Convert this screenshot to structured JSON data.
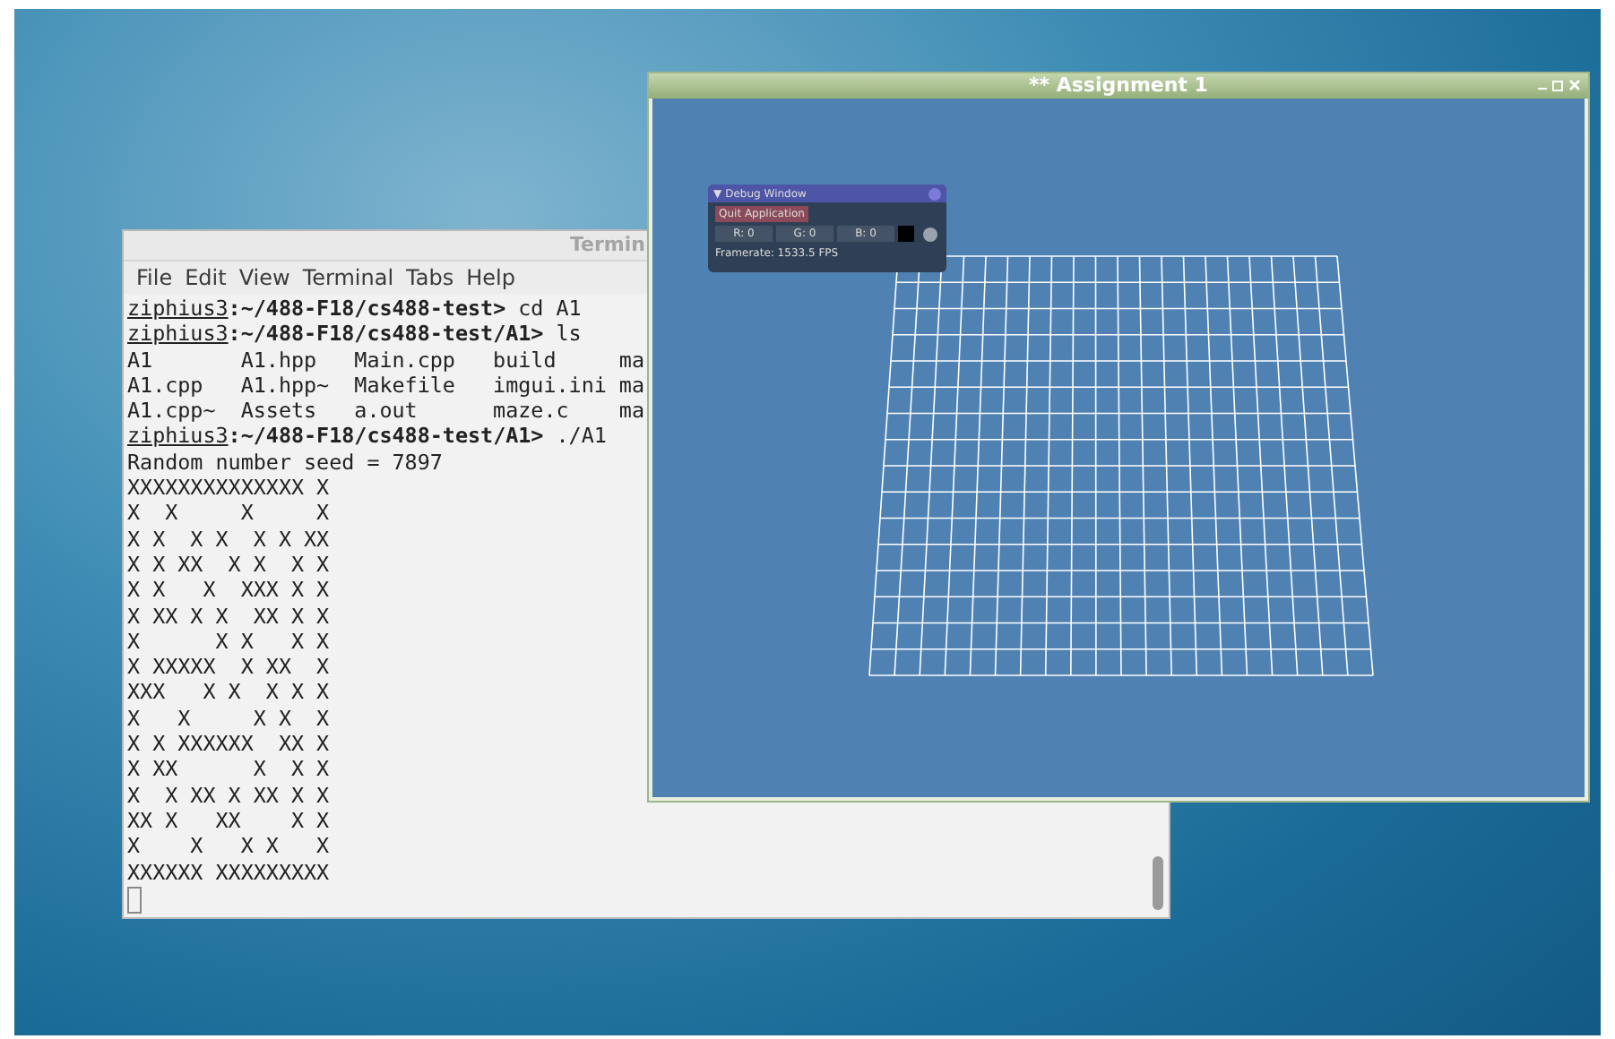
{
  "terminal": {
    "title": "Termin",
    "menu": [
      "File",
      "Edit",
      "View",
      "Terminal",
      "Tabs",
      "Help"
    ],
    "lines": [
      {
        "kind": "prompt",
        "user": "ziphius3",
        "path": ":~/488-F18/cs488-test>",
        "command": " cd A1"
      },
      {
        "kind": "prompt",
        "user": "ziphius3",
        "path": ":~/488-F18/cs488-test/A1>",
        "command": " ls"
      },
      {
        "kind": "output",
        "text": "A1       A1.hpp   Main.cpp   build     ma"
      },
      {
        "kind": "output",
        "text": "A1.cpp   A1.hpp~  Makefile   imgui.ini ma"
      },
      {
        "kind": "output",
        "text": "A1.cpp~  Assets   a.out      maze.c    ma"
      },
      {
        "kind": "prompt",
        "user": "ziphius3",
        "path": ":~/488-F18/cs488-test/A1>",
        "command": " ./A1"
      },
      {
        "kind": "output",
        "text": "Random number seed = 7897"
      },
      {
        "kind": "output",
        "text": "XXXXXXXXXXXXXX X"
      },
      {
        "kind": "output",
        "text": "X  X     X     X"
      },
      {
        "kind": "output",
        "text": "X X  X X  X X XX"
      },
      {
        "kind": "output",
        "text": "X X XX  X X  X X"
      },
      {
        "kind": "output",
        "text": "X X   X  XXX X X"
      },
      {
        "kind": "output",
        "text": "X XX X X  XX X X"
      },
      {
        "kind": "output",
        "text": "X      X X   X X"
      },
      {
        "kind": "output",
        "text": "X XXXXX  X XX  X"
      },
      {
        "kind": "output",
        "text": "XXX   X X  X X X"
      },
      {
        "kind": "output",
        "text": "X   X     X X  X"
      },
      {
        "kind": "output",
        "text": "X X XXXXXX  XX X"
      },
      {
        "kind": "output",
        "text": "X XX      X  X X"
      },
      {
        "kind": "output",
        "text": "X  X XX X XX X X"
      },
      {
        "kind": "output",
        "text": "XX X   XX    X X"
      },
      {
        "kind": "output",
        "text": "X    X   X X   X"
      },
      {
        "kind": "output",
        "text": "XXXXXX XXXXXXXXX"
      }
    ]
  },
  "app_window": {
    "title": "** Assignment 1"
  },
  "debug_window": {
    "collapse": "▼",
    "title": "Debug Window",
    "button": "Quit Application",
    "fields": [
      "R: 0",
      "G: 0",
      "B: 0"
    ],
    "framerate": "Framerate: 1533.5 FPS"
  }
}
